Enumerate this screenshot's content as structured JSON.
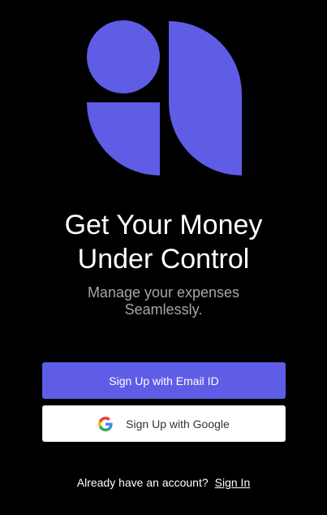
{
  "brand": {
    "accent_color": "#5f5ce6",
    "logo_icon": "app-logo-icon"
  },
  "hero": {
    "title_line1": "Get Your Money",
    "title_line2": "Under Control",
    "subtitle_line1": "Manage your expenses",
    "subtitle_line2": "Seamlessly."
  },
  "actions": {
    "email_signup_label": "Sign Up with Email ID",
    "google_signup_label": "Sign Up with Google",
    "google_icon": "google-icon"
  },
  "footer": {
    "prompt": "Already have an account?",
    "signin_label": "Sign In"
  }
}
